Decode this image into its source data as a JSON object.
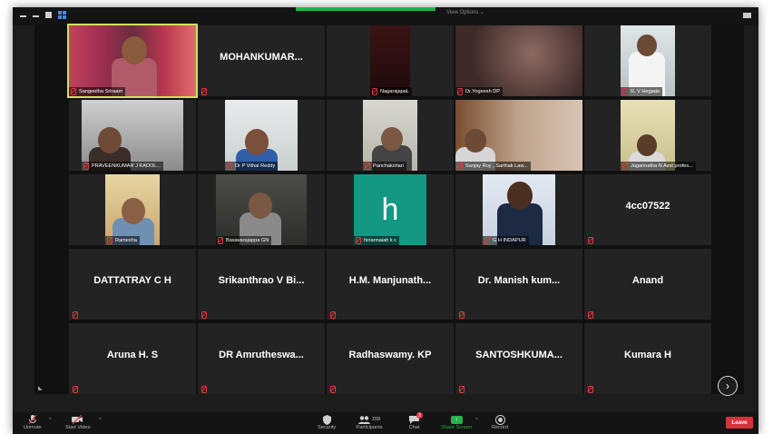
{
  "topbar": {
    "view_label": "View Options ⌄"
  },
  "gallery": {
    "tiles": [
      {
        "kind": "video",
        "label": "Sangeetha Sriraam",
        "active": true
      },
      {
        "kind": "name",
        "name": "MOHANKUMAR..."
      },
      {
        "kind": "video",
        "label": "NagarajapaL"
      },
      {
        "kind": "video",
        "label": "Dr.Yogeesh DP"
      },
      {
        "kind": "video",
        "label": "R. V Hegada"
      },
      {
        "kind": "video",
        "label": "PRAVEENKUMAR J KADOL..."
      },
      {
        "kind": "video",
        "label": "Dr P Vithal Reddy"
      },
      {
        "kind": "video",
        "label": "Panchakshari"
      },
      {
        "kind": "video",
        "label": "Sanjay Roy , Sarthak Law..."
      },
      {
        "kind": "video",
        "label": "Jagannatha N Asst profes..."
      },
      {
        "kind": "video",
        "label": "Ramesha"
      },
      {
        "kind": "video",
        "label": "Basavarajappa GN"
      },
      {
        "kind": "avatar",
        "label": "hiriannaiah k c",
        "letter": "h"
      },
      {
        "kind": "video",
        "label": "G H INDAPUR"
      },
      {
        "kind": "name",
        "name": "4cc07522"
      },
      {
        "kind": "name",
        "name": "DATTATRAY C H"
      },
      {
        "kind": "name",
        "name": "Srikanthrao V Bi..."
      },
      {
        "kind": "name",
        "name": "H.M. Manjunath..."
      },
      {
        "kind": "name",
        "name": "Dr. Manish kum..."
      },
      {
        "kind": "name",
        "name": "Anand"
      },
      {
        "kind": "name",
        "name": "Aruna H. S"
      },
      {
        "kind": "name",
        "name": "DR Amrutheswa..."
      },
      {
        "kind": "name",
        "name": "Radhaswamy. KP"
      },
      {
        "kind": "name",
        "name": "SANTOSHKUMA..."
      },
      {
        "kind": "name",
        "name": "Kumara H"
      }
    ],
    "next_label": "›"
  },
  "toolbar": {
    "unmute": "Unmute",
    "start_video": "Start Video",
    "security": "Security",
    "participants": "Participants",
    "participants_count": "159",
    "chat": "Chat",
    "chat_badge": "2",
    "share_screen": "Share Screen",
    "record": "Record",
    "leave": "Leave"
  },
  "colors": {
    "accent_green": "#22b14c",
    "leave_red": "#d9313b",
    "active_speaker": "#d3e05a",
    "avatar_teal": "#149883"
  }
}
